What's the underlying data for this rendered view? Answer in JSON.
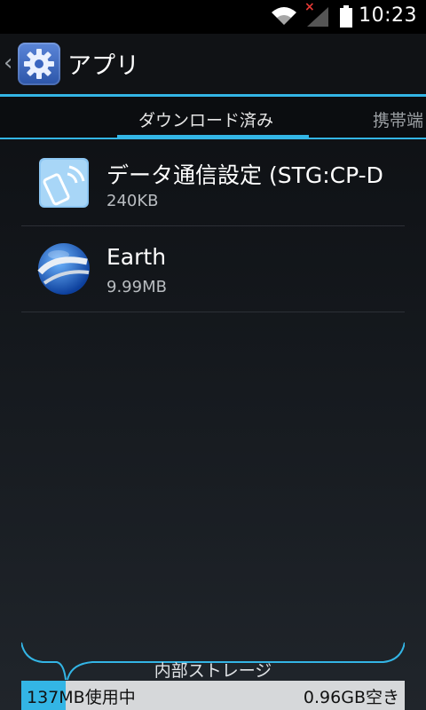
{
  "status_bar": {
    "time": "10:23",
    "no_signal_mark": "×"
  },
  "action_bar": {
    "up_caret": "‹",
    "title": "アプリ",
    "icon": "gear-icon"
  },
  "tabs": [
    {
      "label": "ダウンロード済み",
      "selected": true
    },
    {
      "label": "携帯端",
      "selected": false
    }
  ],
  "apps": [
    {
      "name": "データ通信設定 (STG:CP-D",
      "size": "240KB",
      "icon": "phone-signal-icon"
    },
    {
      "name": "Earth",
      "size": "9.99MB",
      "icon": "earth-globe-icon"
    }
  ],
  "storage": {
    "label": "内部ストレージ",
    "used": "137MB使用中",
    "free": "0.96GB空き",
    "accent": "#33b5e5"
  }
}
